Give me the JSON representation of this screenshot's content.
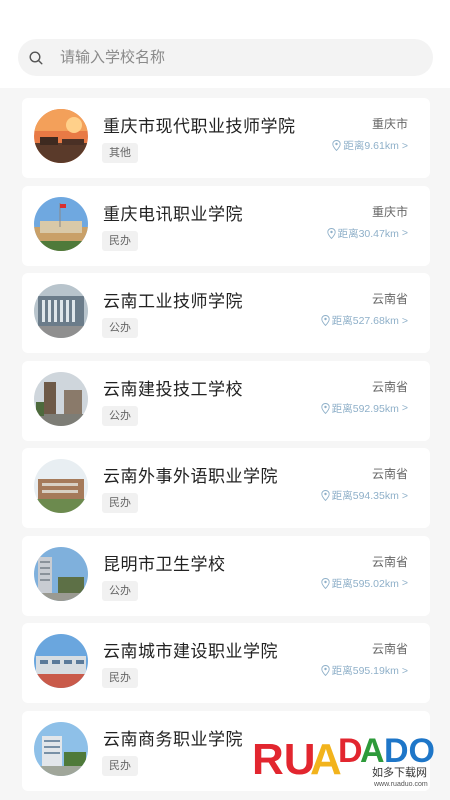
{
  "search": {
    "placeholder": "请输入学校名称"
  },
  "colors": {
    "accent": "#8fb0c9",
    "card_bg": "#ffffff",
    "page_bg": "#f6f6f6"
  },
  "schools": [
    {
      "name": "重庆市现代职业技师学院",
      "type": "其他",
      "region": "重庆市",
      "distance": "距离9.61km",
      "arrow": ">"
    },
    {
      "name": "重庆电讯职业学院",
      "type": "民办",
      "region": "重庆市",
      "distance": "距离30.47km",
      "arrow": ">"
    },
    {
      "name": "云南工业技师学院",
      "type": "公办",
      "region": "云南省",
      "distance": "距离527.68km",
      "arrow": ">"
    },
    {
      "name": "云南建投技工学校",
      "type": "公办",
      "region": "云南省",
      "distance": "距离592.95km",
      "arrow": ">"
    },
    {
      "name": "云南外事外语职业学院",
      "type": "民办",
      "region": "云南省",
      "distance": "距离594.35km",
      "arrow": ">"
    },
    {
      "name": "昆明市卫生学校",
      "type": "公办",
      "region": "云南省",
      "distance": "距离595.02km",
      "arrow": ">"
    },
    {
      "name": "云南城市建设职业学院",
      "type": "民办",
      "region": "云南省",
      "distance": "距离595.19km",
      "arrow": ">"
    },
    {
      "name": "云南商务职业学院",
      "type": "民办",
      "region": "",
      "distance": "",
      "arrow": ""
    }
  ],
  "watermark": {
    "brand": "RUANDADO",
    "cn": "如多下载网",
    "url": "www.ruaduo.com"
  }
}
